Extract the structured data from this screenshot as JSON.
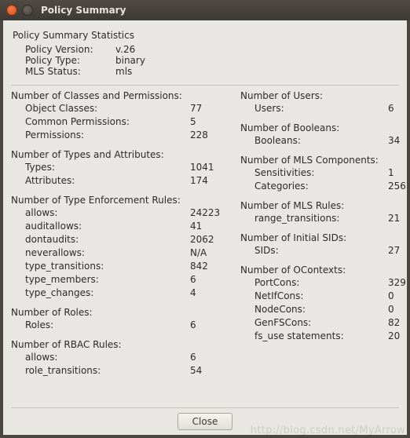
{
  "window": {
    "title": "Policy Summary"
  },
  "summary": {
    "heading": "Policy Summary Statistics",
    "rows": [
      {
        "label": "Policy Version:",
        "value": "v.26"
      },
      {
        "label": "Policy Type:",
        "value": "binary"
      },
      {
        "label": "MLS Status:",
        "value": "mls"
      }
    ]
  },
  "left_sections": [
    {
      "heading": "Number of Classes and Permissions:",
      "rows": [
        {
          "label": "Object Classes:",
          "value": "77"
        },
        {
          "label": "Common Permissions:",
          "value": "5"
        },
        {
          "label": "Permissions:",
          "value": "228"
        }
      ]
    },
    {
      "heading": "Number of Types and Attributes:",
      "rows": [
        {
          "label": "Types:",
          "value": "1041"
        },
        {
          "label": "Attributes:",
          "value": "174"
        }
      ]
    },
    {
      "heading": "Number of Type Enforcement Rules:",
      "rows": [
        {
          "label": "allows:",
          "value": "24223"
        },
        {
          "label": "auditallows:",
          "value": "41"
        },
        {
          "label": "dontaudits:",
          "value": "2062"
        },
        {
          "label": "neverallows:",
          "value": "N/A"
        },
        {
          "label": "type_transitions:",
          "value": "842"
        },
        {
          "label": "type_members:",
          "value": "6"
        },
        {
          "label": "type_changes:",
          "value": "4"
        }
      ]
    },
    {
      "heading": "Number of Roles:",
      "rows": [
        {
          "label": "Roles:",
          "value": "6"
        }
      ]
    },
    {
      "heading": "Number of RBAC Rules:",
      "rows": [
        {
          "label": "allows:",
          "value": "6"
        },
        {
          "label": "role_transitions:",
          "value": "54"
        }
      ]
    }
  ],
  "right_sections": [
    {
      "heading": "Number of Users:",
      "rows": [
        {
          "label": "Users:",
          "value": "6"
        }
      ]
    },
    {
      "heading": "Number of Booleans:",
      "rows": [
        {
          "label": "Booleans:",
          "value": "34"
        }
      ]
    },
    {
      "heading": "Number of MLS Components:",
      "rows": [
        {
          "label": "Sensitivities:",
          "value": "1"
        },
        {
          "label": "Categories:",
          "value": "256"
        }
      ]
    },
    {
      "heading": "Number of MLS Rules:",
      "rows": [
        {
          "label": "range_transitions:",
          "value": "21"
        }
      ]
    },
    {
      "heading": "Number of Initial SIDs:",
      "rows": [
        {
          "label": "SIDs:",
          "value": "27"
        }
      ]
    },
    {
      "heading": "Number of OContexts:",
      "rows": [
        {
          "label": "PortCons:",
          "value": "329"
        },
        {
          "label": "NetIfCons:",
          "value": "0"
        },
        {
          "label": "NodeCons:",
          "value": "0"
        },
        {
          "label": "GenFSCons:",
          "value": "82"
        },
        {
          "label": "fs_use statements:",
          "value": "20"
        }
      ]
    }
  ],
  "footer": {
    "close_label": "Close"
  },
  "watermark": "http://blog.csdn.net/MyArrow"
}
